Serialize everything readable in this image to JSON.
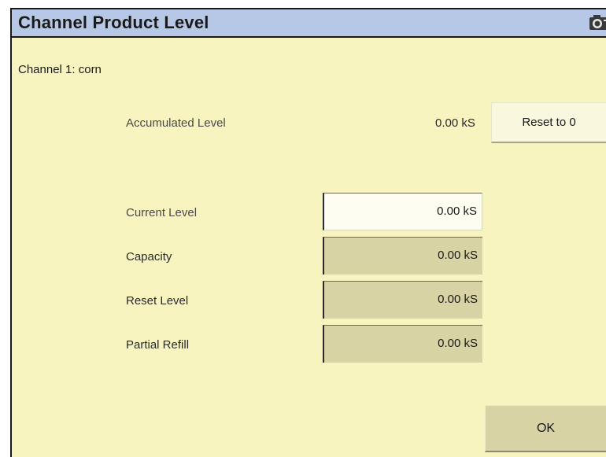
{
  "window": {
    "title": "Channel Product Level",
    "title_icon": "camera-icon"
  },
  "channel": {
    "label": "Channel 1: corn"
  },
  "accumulated": {
    "label": "Accumulated Level",
    "value": "0.00 kS",
    "reset_button": "Reset to 0"
  },
  "fields": {
    "current_level": {
      "label": "Current Level",
      "value": "0.00 kS"
    },
    "capacity": {
      "label": "Capacity",
      "value": "0.00 kS"
    },
    "reset_level": {
      "label": "Reset Level",
      "value": "0.00 kS"
    },
    "partial_refill": {
      "label": "Partial Refill",
      "value": "0.00 kS"
    }
  },
  "actions": {
    "ok_label": "OK"
  },
  "colors": {
    "background": "#f7f4c0",
    "titlebar": "#b7c8e6",
    "readonly_field": "#d8d3a4",
    "editable_field": "#fdfdf2"
  }
}
